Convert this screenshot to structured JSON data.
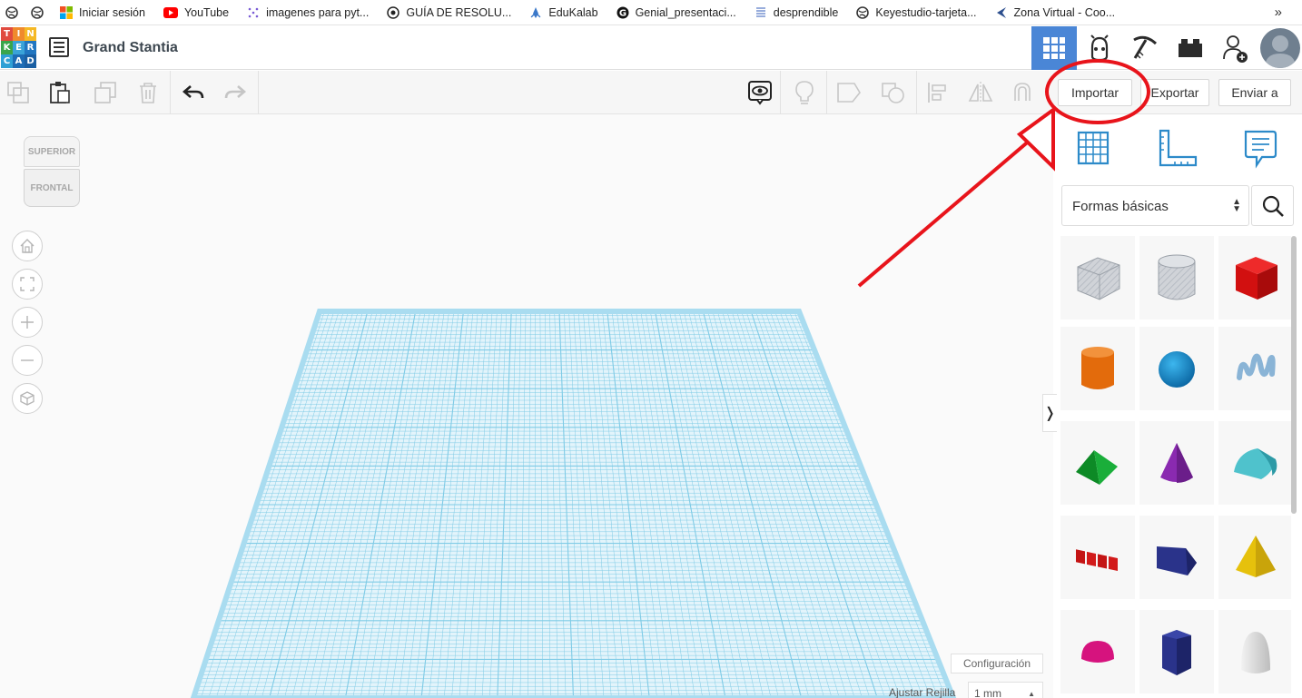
{
  "bookmarks": [
    {
      "label": "",
      "icon": "globe-icon"
    },
    {
      "label": "",
      "icon": "globe-icon"
    },
    {
      "label": "Iniciar sesión",
      "icon": "microsoft-icon"
    },
    {
      "label": "YouTube",
      "icon": "youtube-icon"
    },
    {
      "label": "imagenes para pyt...",
      "icon": "dots-icon"
    },
    {
      "label": "GUÍA DE RESOLU...",
      "icon": "eye-icon"
    },
    {
      "label": "EduKalab",
      "icon": "rocket-icon"
    },
    {
      "label": "Genial_presentaci...",
      "icon": "g-icon"
    },
    {
      "label": "desprendible",
      "icon": "doc-icon"
    },
    {
      "label": "Keyestudio-tarjeta...",
      "icon": "globe-icon"
    },
    {
      "label": "Zona Virtual - Coo...",
      "icon": "arrow-icon"
    }
  ],
  "bookmarks_more": "»",
  "logo": {
    "letters": [
      "T",
      "I",
      "N",
      "K",
      "E",
      "R",
      "C",
      "A",
      "D"
    ]
  },
  "header": {
    "project_title": "Grand Stantia"
  },
  "toolbar": {
    "import_label": "Importar",
    "export_label": "Exportar",
    "send_label": "Enviar a"
  },
  "viewcube": {
    "top_label": "SUPERIOR",
    "front_label": "FRONTAL"
  },
  "panel": {
    "category": "Formas básicas",
    "shapes": [
      "box-hole",
      "cylinder-hole",
      "box",
      "cylinder",
      "sphere",
      "scribble",
      "roof",
      "cone",
      "round-roof",
      "text",
      "wedge",
      "pyramid",
      "half-sphere",
      "polygon",
      "paraboloid"
    ]
  },
  "bottom": {
    "config_label": "Configuración",
    "snap_label": "Ajustar Rejilla",
    "snap_value": "1 mm"
  },
  "colors": {
    "grid": "#7fcbe6",
    "active_view": "#4a86d6",
    "annotation": "#e8141b"
  }
}
